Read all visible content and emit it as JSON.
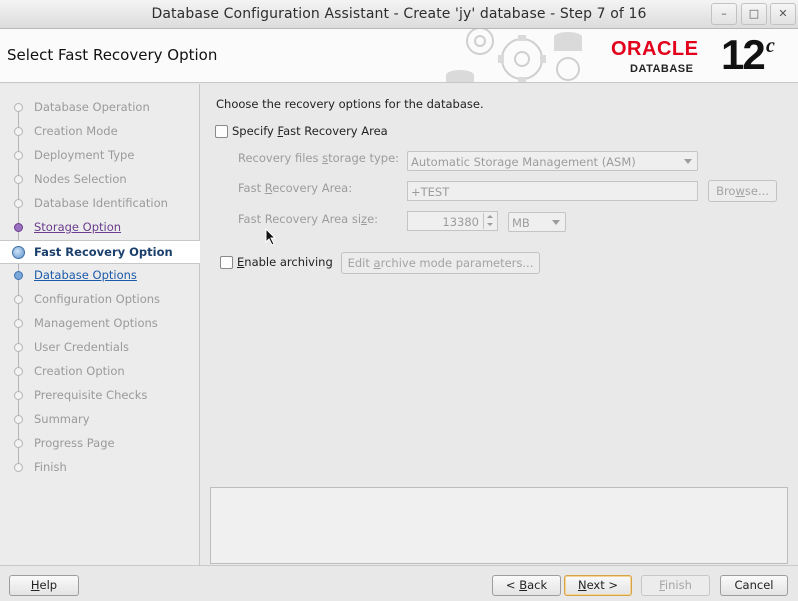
{
  "window": {
    "title": "Database Configuration Assistant - Create 'jy' database - Step 7 of 16",
    "controls": [
      "minimize",
      "maximize",
      "close"
    ]
  },
  "header": {
    "page_title": "Select Fast Recovery Option",
    "logo_brand": "ORACLE",
    "logo_product": "DATABASE",
    "logo_version": "12",
    "logo_version_suffix": "c"
  },
  "sidebar": {
    "steps": [
      {
        "label": "Database Operation",
        "state": "done"
      },
      {
        "label": "Creation Mode",
        "state": "done"
      },
      {
        "label": "Deployment Type",
        "state": "done"
      },
      {
        "label": "Nodes Selection",
        "state": "done"
      },
      {
        "label": "Database Identification",
        "state": "done"
      },
      {
        "label": "Storage Option",
        "state": "visited"
      },
      {
        "label": "Fast Recovery Option",
        "state": "current"
      },
      {
        "label": "Database Options",
        "state": "link"
      },
      {
        "label": "Configuration Options",
        "state": "pending"
      },
      {
        "label": "Management Options",
        "state": "pending"
      },
      {
        "label": "User Credentials",
        "state": "pending"
      },
      {
        "label": "Creation Option",
        "state": "pending"
      },
      {
        "label": "Prerequisite Checks",
        "state": "pending"
      },
      {
        "label": "Summary",
        "state": "pending"
      },
      {
        "label": "Progress Page",
        "state": "pending"
      },
      {
        "label": "Finish",
        "state": "pending"
      }
    ]
  },
  "main": {
    "intro": "Choose the recovery options for the database.",
    "specify_fra": {
      "pre": "Specify ",
      "mnemonic": "F",
      "post": "ast Recovery Area",
      "checked": false
    },
    "storage_type": {
      "label_pre": "Recovery files ",
      "label_mnemonic": "s",
      "label_post": "torage type:",
      "value": "Automatic Storage Management (ASM)"
    },
    "fra_location": {
      "label_pre": "Fast ",
      "label_mnemonic": "R",
      "label_post": "ecovery Area:",
      "value": "+TEST",
      "browse_pre": "Bro",
      "browse_mnemonic": "w",
      "browse_post": "se..."
    },
    "fra_size": {
      "label_pre": "Fast Recovery Area si",
      "label_mnemonic": "z",
      "label_post": "e:",
      "value": "13380",
      "unit": "MB"
    },
    "archiving": {
      "mnemonic": "E",
      "post": "nable archiving",
      "checked": false,
      "edit_pre": "Edit ",
      "edit_mnemonic": "a",
      "edit_post": "rchive mode parameters..."
    }
  },
  "footer": {
    "help": {
      "mnemonic": "H",
      "post": "elp"
    },
    "back": {
      "pre": "< ",
      "mnemonic": "B",
      "post": "ack"
    },
    "next": {
      "mnemonic": "N",
      "post": "ext >"
    },
    "finish": {
      "mnemonic": "F",
      "post": "inish"
    },
    "cancel": "Cancel"
  },
  "colors": {
    "accent": "#1a5aa8",
    "visited": "#6b3d8d",
    "brand_red": "#e2001a"
  }
}
